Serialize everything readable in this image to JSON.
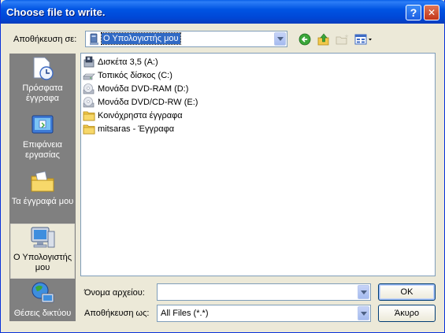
{
  "window": {
    "title": "Choose file to write.",
    "help_glyph": "?",
    "close_glyph": "✕"
  },
  "location": {
    "label": "Αποθήκευση σε:",
    "value": "Ο Υπολογιστής μου"
  },
  "toolbar": {
    "back_icon": "back-arrow-icon",
    "up_icon": "up-folder-icon",
    "new_folder_icon": "new-folder-icon",
    "views_icon": "views-menu-icon"
  },
  "places": [
    {
      "label": "Πρόσφατα έγγραφα",
      "icon": "recent-documents-icon"
    },
    {
      "label": "Επιφάνεια εργασίας",
      "icon": "desktop-icon"
    },
    {
      "label": "Τα έγγραφά μου",
      "icon": "my-documents-icon"
    },
    {
      "label": "Ο Υπολογιστής μου",
      "icon": "my-computer-icon",
      "selected": true
    },
    {
      "label": "Θέσεις δικτύου",
      "icon": "network-places-icon"
    }
  ],
  "files": [
    {
      "name": "Δισκέτα 3,5 (A:)",
      "icon": "floppy-drive-icon"
    },
    {
      "name": "Τοπικός δίσκος (C:)",
      "icon": "hard-disk-icon"
    },
    {
      "name": "Μονάδα DVD-RAM (D:)",
      "icon": "dvd-ram-drive-icon"
    },
    {
      "name": "Μονάδα DVD/CD-RW (E:)",
      "icon": "dvd-cdrw-drive-icon"
    },
    {
      "name": "Κοινόχρηστα έγγραφα",
      "icon": "folder-icon"
    },
    {
      "name": "mitsaras - Έγγραφα",
      "icon": "folder-icon"
    }
  ],
  "filename": {
    "label": "Όνομα αρχείου:",
    "value": ""
  },
  "filetype": {
    "label": "Αποθήκευση ως:",
    "value": "All Files (*.*)"
  },
  "buttons": {
    "ok": "OK",
    "cancel": "Άκυρο"
  },
  "colors": {
    "title_bar": "#0054e3",
    "dialog_face": "#ece9d8",
    "places_bar": "#808080",
    "selection": "#316ac5"
  }
}
